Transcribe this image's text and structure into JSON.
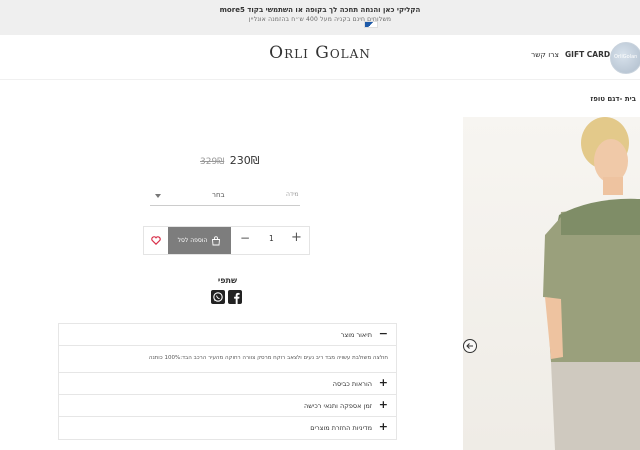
{
  "promo": {
    "line1": "הקליקי כאן והנחה תחכה לך בקופה או השתמשי בקוד more5",
    "line2": "משלוחים חינם בקניה מעל 400 ש״ח בהזמנה אונליין"
  },
  "header": {
    "logo_first": "O",
    "logo_first_rest": "RLI",
    "logo_last": "G",
    "logo_last_rest": "OLAN",
    "gift_card": "GIFT CARD",
    "contact": "צרו קשר",
    "avatar_text": "OrliGolan"
  },
  "breadcrumb": "בית -דגם טופז",
  "product": {
    "price": "230₪",
    "old_price": "329₪",
    "size_label": "מידה",
    "size_value": "בחר",
    "add_to_cart": "הוספה לסל",
    "quantity": "1",
    "minus": "−",
    "plus": "+"
  },
  "share": {
    "label": "שתפי"
  },
  "accordion": [
    {
      "title": "תיאור מוצר",
      "sign": "−",
      "open": true
    },
    {
      "description": "חולצה משולבת עשויה מבד ריב נעים ולצאב רוקח מרסק צוורה רחוקה מהעיר הרכב הבד:100% כותנה"
    },
    {
      "title": "הוראות כביסה",
      "sign": "+"
    },
    {
      "title": "זמן אספקה ותנאי רכישה",
      "sign": "+"
    },
    {
      "title": "מדיניות החזרת מוצרים",
      "sign": "+"
    }
  ],
  "colors": {
    "promo_bg": "#efefef",
    "add_button_bg": "#7d7d7d",
    "heart": "#d8304a",
    "shirt_green": "#7f8d67",
    "shirt_khaki": "#9aa07c",
    "pants": "#cfc9bf"
  },
  "icons": {
    "wishlist": "heart-icon",
    "cart": "shopping-bag-icon",
    "whatsapp": "whatsapp-icon",
    "facebook": "facebook-icon",
    "prev": "arrow-left-circle-icon"
  }
}
